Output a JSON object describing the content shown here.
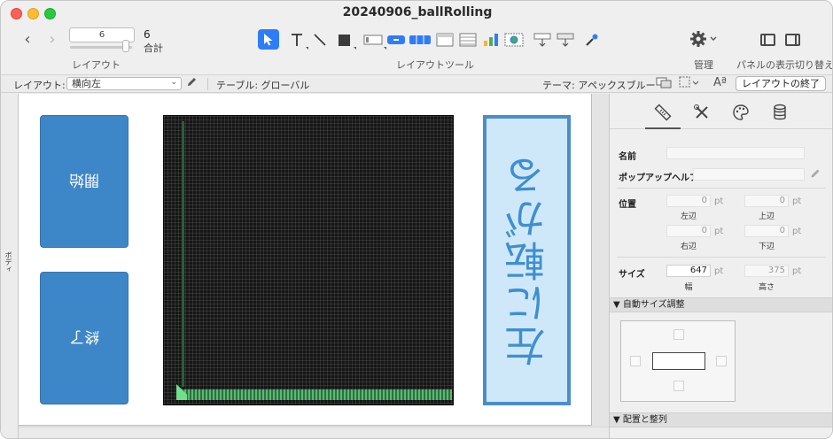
{
  "window": {
    "title": "20240906_ballRolling"
  },
  "toolbar": {
    "layout_number": "6",
    "total_count": "6",
    "total_label": "合計",
    "layout_caption": "レイアウト",
    "layout_tools_caption": "レイアウトツール",
    "manage_caption": "管理",
    "panel_toggle_caption": "パネルの表示切り替え",
    "tools": [
      "select-tool",
      "text-tool",
      "line-tool",
      "shape-tool",
      "field-tool",
      "button-tool",
      "button-bar-tool",
      "popover-tool",
      "portal-tool",
      "chart-tool",
      "web-viewer-tool",
      "insert-field-tool",
      "insert-part-tool",
      "format-painter-tool"
    ]
  },
  "layoutbar": {
    "layout_label": "レイアウト:",
    "layout_value": "横向左",
    "table_label": "テーブル: グローバル",
    "theme_label": "テーマ: アペックスブルー",
    "exit_button": "レイアウトの終了"
  },
  "canvas": {
    "part_label": "ボディ",
    "start_button": "開始",
    "end_button": "終了",
    "rotate_panel_text": "左に転がる"
  },
  "inspector": {
    "name_label": "名前",
    "popup_help_label": "ポップアップヘルプ",
    "position_label": "位置",
    "left": {
      "value": "0",
      "unit": "pt",
      "caption": "左辺"
    },
    "top": {
      "value": "0",
      "unit": "pt",
      "caption": "上辺"
    },
    "right": {
      "value": "0",
      "unit": "pt",
      "caption": "右辺"
    },
    "bottom": {
      "value": "0",
      "unit": "pt",
      "caption": "下辺"
    },
    "size_label": "サイズ",
    "width": {
      "value": "647",
      "unit": "pt",
      "caption": "幅"
    },
    "height": {
      "value": "375",
      "unit": "pt",
      "caption": "高さ"
    },
    "autosize_header": "▼ 自動サイズ調整",
    "arrange_header": "▼ 配置と整列"
  },
  "colors": {
    "accent": "#2f7df6",
    "button_blue": "#3d87c8",
    "panel_light_blue": "#cfe8f9",
    "panel_border": "#4a8dcb",
    "webview_bg": "#161616",
    "floor_green": "#5ec97a"
  }
}
